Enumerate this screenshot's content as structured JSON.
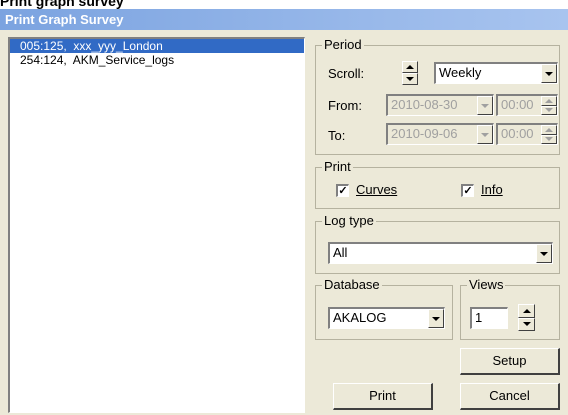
{
  "outer_title": "Print graph survey",
  "window_title": "Print Graph Survey",
  "list": {
    "items": [
      {
        "label": "005:125,  xxx_yyy_London",
        "selected": true
      },
      {
        "label": "254:124,  AKM_Service_logs",
        "selected": false
      }
    ]
  },
  "period": {
    "title": "Period",
    "scroll_label": "Scroll:",
    "scroll_value": "Weekly",
    "from_label": "From:",
    "from_date": "2010-08-30",
    "from_time": "00:00",
    "to_label": "To:",
    "to_date": "2010-09-06",
    "to_time": "00:00"
  },
  "print": {
    "title": "Print",
    "curves_label": "Curves",
    "curves_checked": "✓",
    "info_label": "Info",
    "info_checked": "✓"
  },
  "log_type": {
    "title": "Log type",
    "value": "All"
  },
  "database": {
    "title": "Database",
    "value": "AKALOG"
  },
  "views": {
    "title": "Views",
    "value": "1"
  },
  "buttons": {
    "setup": "Setup",
    "print": "Print",
    "cancel": "Cancel"
  }
}
